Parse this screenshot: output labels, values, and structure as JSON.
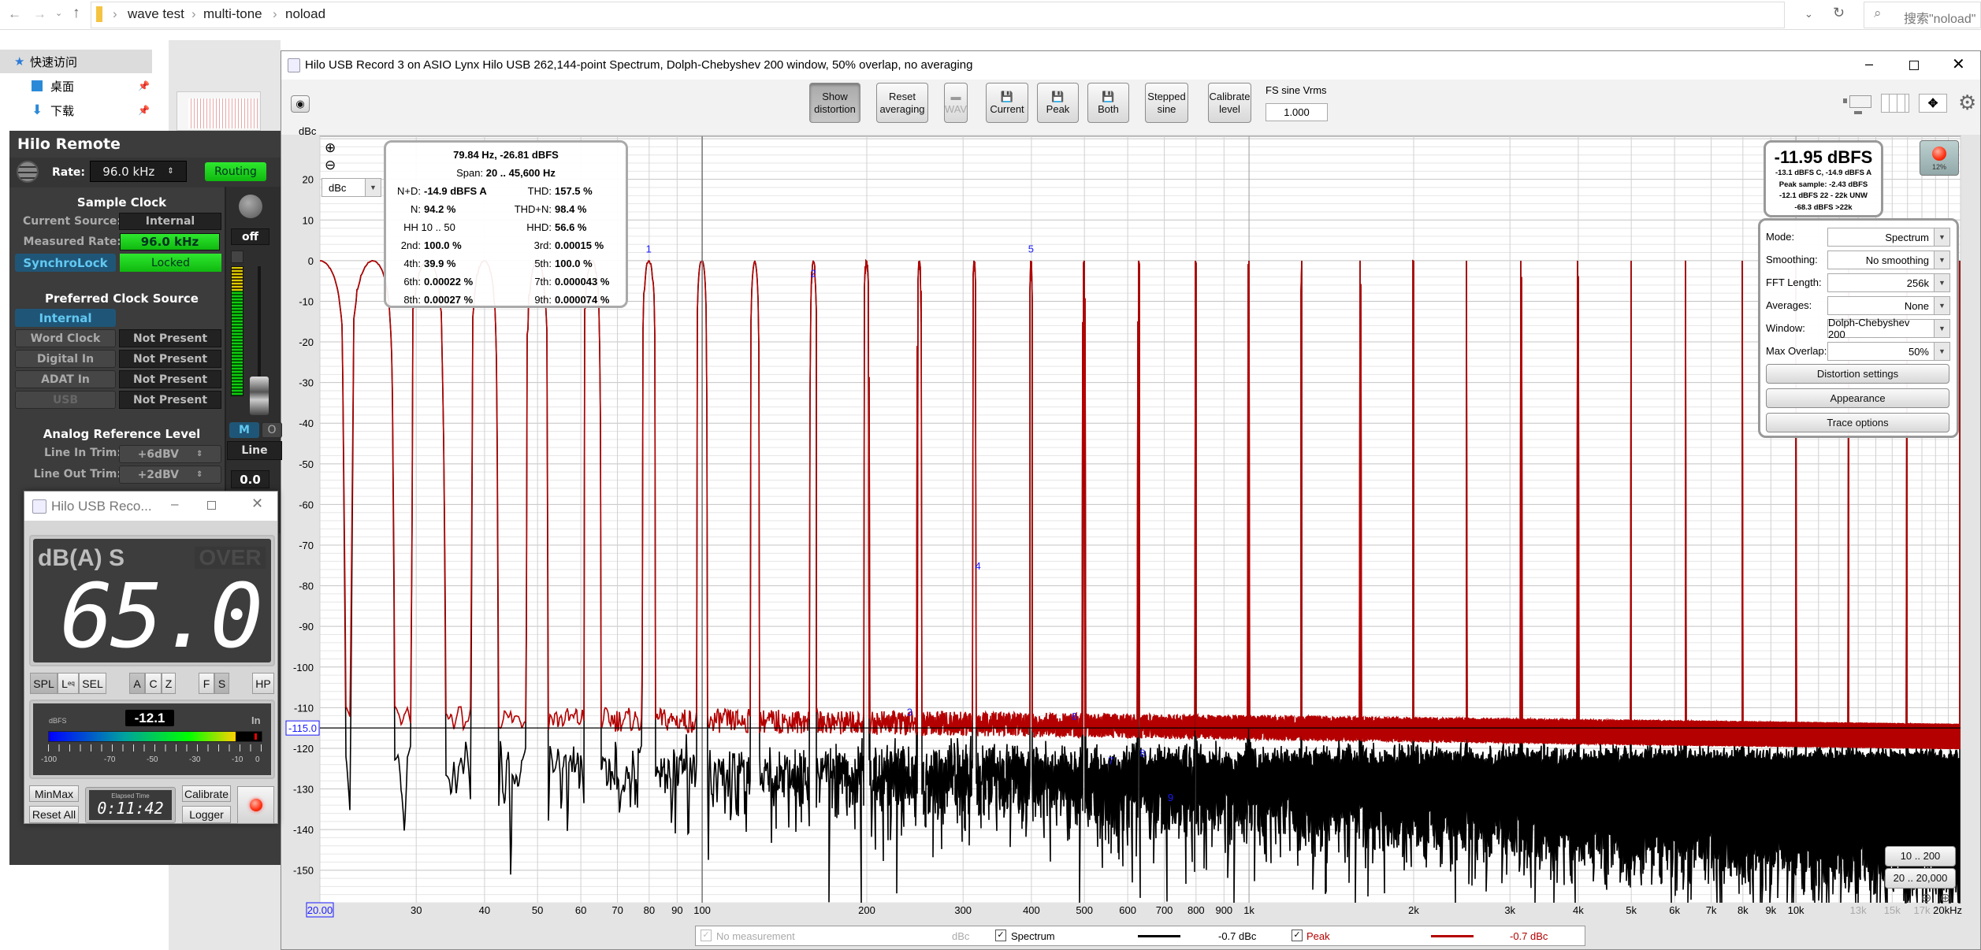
{
  "explorer": {
    "breadcrumb": [
      "wave test",
      "multi-tone",
      "noload"
    ],
    "search_placeholder": "搜索\"noload\"",
    "sidebar": [
      "快速访问",
      "桌面",
      "下载"
    ]
  },
  "window": {
    "title": "Hilo USB Record 3 on ASIO Lynx Hilo USB 262,144-point Spectrum, Dolph-Chebyshev 200 window, 50% overlap, no averaging",
    "toolbar": {
      "show_distortion": [
        "Show",
        "distortion"
      ],
      "reset_averaging": [
        "Reset",
        "averaging"
      ],
      "wav": "WAV",
      "current": "Current",
      "peak": "Peak",
      "both": "Both",
      "stepped_sine": [
        "Stepped",
        "sine"
      ],
      "calibrate_level": [
        "Calibrate",
        "level"
      ],
      "fs_label": "FS sine Vrms",
      "fs_value": "1.000"
    },
    "y_unit_select": "dBc",
    "cursor_info": {
      "title": "79.84 Hz, -26.81 dBFS",
      "span_label": "Span:",
      "span_value": "20 .. 45,600 Hz",
      "rows": [
        {
          "l": "N+D:",
          "lv": "-14.9 dBFS A",
          "r": "THD:",
          "rv": "157.5 %"
        },
        {
          "l": "N:",
          "lv": "94.2 %",
          "r": "THD+N:",
          "rv": "98.4 %"
        },
        {
          "l": "HH 10 .. 50",
          "lv": "",
          "r": "HHD:",
          "rv": "56.6 %"
        },
        {
          "l": "2nd:",
          "lv": "100.0 %",
          "r": "3rd:",
          "rv": "0.00015 %"
        },
        {
          "l": "4th:",
          "lv": "39.9 %",
          "r": "5th:",
          "rv": "100.0 %"
        },
        {
          "l": "6th:",
          "lv": "0.00022 %",
          "r": "7th:",
          "rv": "0.000043 %"
        },
        {
          "l": "8th:",
          "lv": "0.00027 %",
          "r": "9th:",
          "rv": "0.000074 %"
        }
      ]
    },
    "level_box": {
      "main": "-11.95 dBFS",
      "lines": [
        "-13.1 dBFS C, -14.9 dBFS A",
        "Peak sample: -2.43 dBFS",
        "-12.1 dBFS 22 - 22k UNW",
        "-68.3 dBFS >22k"
      ]
    },
    "record_percent": "12%",
    "settings": [
      {
        "label": "Mode:",
        "value": "Spectrum"
      },
      {
        "label": "Smoothing:",
        "value": "No  smoothing"
      },
      {
        "label": "FFT Length:",
        "value": "256k"
      },
      {
        "label": "Averages:",
        "value": "None"
      },
      {
        "label": "Window:",
        "value": "Dolph-Chebyshev 200"
      },
      {
        "label": "Max Overlap:",
        "value": "50%"
      }
    ],
    "buttons": {
      "distortion": "Distortion settings",
      "appearance": "Appearance",
      "trace": "Trace options"
    },
    "range_buttons": [
      "10 .. 200",
      "20 .. 20,000"
    ],
    "legend": {
      "no_measurement": "No measurement",
      "unit": "dBc",
      "spectrum": "Spectrum",
      "spectrum_value": "-0.7 dBc",
      "peak": "Peak",
      "peak_value": "-0.7 dBc"
    }
  },
  "chart_data": {
    "type": "line",
    "ylabel": "dBc",
    "x_scale": "log",
    "xlim": [
      20,
      20000
    ],
    "ylim": [
      -158,
      30.6
    ],
    "grid": true,
    "x_ticks": [
      {
        "v": 20,
        "t": "20.00"
      },
      {
        "v": 30,
        "t": "30"
      },
      {
        "v": 40,
        "t": "40"
      },
      {
        "v": 50,
        "t": "50"
      },
      {
        "v": 60,
        "t": "60"
      },
      {
        "v": 70,
        "t": "70"
      },
      {
        "v": 80,
        "t": "80"
      },
      {
        "v": 90,
        "t": "90"
      },
      {
        "v": 100,
        "t": "100"
      },
      {
        "v": 200,
        "t": "200"
      },
      {
        "v": 300,
        "t": "300"
      },
      {
        "v": 400,
        "t": "400"
      },
      {
        "v": 500,
        "t": "500"
      },
      {
        "v": 600,
        "t": "600"
      },
      {
        "v": 700,
        "t": "700"
      },
      {
        "v": 800,
        "t": "800"
      },
      {
        "v": 900,
        "t": "900"
      },
      {
        "v": 1000,
        "t": "1k"
      },
      {
        "v": 2000,
        "t": "2k"
      },
      {
        "v": 3000,
        "t": "3k"
      },
      {
        "v": 4000,
        "t": "4k"
      },
      {
        "v": 5000,
        "t": "5k"
      },
      {
        "v": 6000,
        "t": "6k"
      },
      {
        "v": 7000,
        "t": "7k"
      },
      {
        "v": 8000,
        "t": "8k"
      },
      {
        "v": 9000,
        "t": "9k"
      },
      {
        "v": 10000,
        "t": "10k"
      },
      {
        "v": 13000,
        "t": "13k",
        "dim": true
      },
      {
        "v": 15000,
        "t": "15k",
        "dim": true
      },
      {
        "v": 17000,
        "t": "17k",
        "dim": true
      },
      {
        "v": 20000,
        "t": "20kHz"
      }
    ],
    "y_ticks": [
      20,
      10,
      0,
      -10,
      -20,
      -30,
      -40,
      -50,
      -60,
      -70,
      -80,
      -90,
      -100,
      -110,
      -120,
      -130,
      -140,
      -150
    ],
    "tone_frequencies_hz": [
      20,
      25,
      31.5,
      40,
      50,
      63,
      80,
      100,
      125,
      160,
      200,
      250,
      315,
      400,
      500,
      630,
      800,
      1000,
      1250,
      1600,
      2000,
      2500,
      3150,
      4000,
      5000,
      6300,
      8000,
      10000,
      12500,
      16000,
      20000
    ],
    "tone_level_dBc": 0,
    "series": [
      {
        "name": "Spectrum",
        "color": "#000000",
        "noise_floor_dBc": {
          "20": -123,
          "20000": -129
        }
      },
      {
        "name": "Peak",
        "color": "#b40000",
        "noise_floor_dBc": {
          "20": -112,
          "20000": -117
        }
      }
    ],
    "harmonic_markers": [
      {
        "label": "1",
        "freq": 79.84,
        "level": 2
      },
      {
        "label": "2",
        "freq": 159.7,
        "level": -4
      },
      {
        "label": "3",
        "freq": 239.5,
        "level": -112
      },
      {
        "label": "4",
        "freq": 319.4,
        "level": -76
      },
      {
        "label": "5",
        "freq": 399.2,
        "level": 2
      },
      {
        "label": "6",
        "freq": 479.0,
        "level": -113
      },
      {
        "label": "7",
        "freq": 558.9,
        "level": -124
      },
      {
        "label": "8",
        "freq": 638.7,
        "level": -122
      },
      {
        "label": "9",
        "freq": 718.6,
        "level": -133
      }
    ],
    "cursor_freq_hz": 100,
    "reference_level": {
      "value": -115.0,
      "label": "-115.0"
    },
    "marker_color": "#1a1aff"
  },
  "remote": {
    "title": "Hilo Remote",
    "rate_label": "Rate:",
    "rate_value": "96.0 kHz",
    "routing": "Routing",
    "sample_clock": "Sample Clock",
    "current_source_label": "Current Source:",
    "current_source": "Internal",
    "measured_rate_label": "Measured Rate:",
    "measured_rate": "96.0 kHz",
    "synchrolock": "SynchroLock",
    "locked": "Locked",
    "preferred": "Preferred Clock Source",
    "sources": [
      {
        "name": "Internal",
        "status": ""
      },
      {
        "name": "Word Clock",
        "status": "Not Present"
      },
      {
        "name": "Digital In",
        "status": "Not Present"
      },
      {
        "name": "ADAT In",
        "status": "Not Present"
      },
      {
        "name": "USB",
        "status": "Not Present"
      }
    ],
    "analog_ref": "Analog Reference Level",
    "line_in_label": "Line In Trim:",
    "line_in": "+6dBV",
    "line_out_label": "Line Out Trim:",
    "line_out": "+2dBV",
    "strip": {
      "pan": "off",
      "mute": "M",
      "solo": "O",
      "input": "Line",
      "gain": "0.0"
    }
  },
  "meter_window": {
    "title": "Hilo USB Reco...",
    "mode": "dB(A) S",
    "over": "OVER",
    "reading": "65.0",
    "buttons": [
      "SPL",
      "L",
      "SEL",
      "A",
      "C",
      "Z",
      "F",
      "S",
      "HP"
    ],
    "leq_sub": "eq",
    "dbfs_label": "dBFS",
    "dbfs_value": "-12.1",
    "dbfs_level": -12.1,
    "in_label": "In",
    "scale": [
      "-100",
      "-70",
      "-50",
      "-30",
      "-10",
      "0"
    ],
    "minmax": "MinMax",
    "reset_all": "Reset All",
    "elapsed_label": "Elapsed Time",
    "elapsed": "0:11:42",
    "calibrate": "Calibrate",
    "logger": "Logger"
  }
}
